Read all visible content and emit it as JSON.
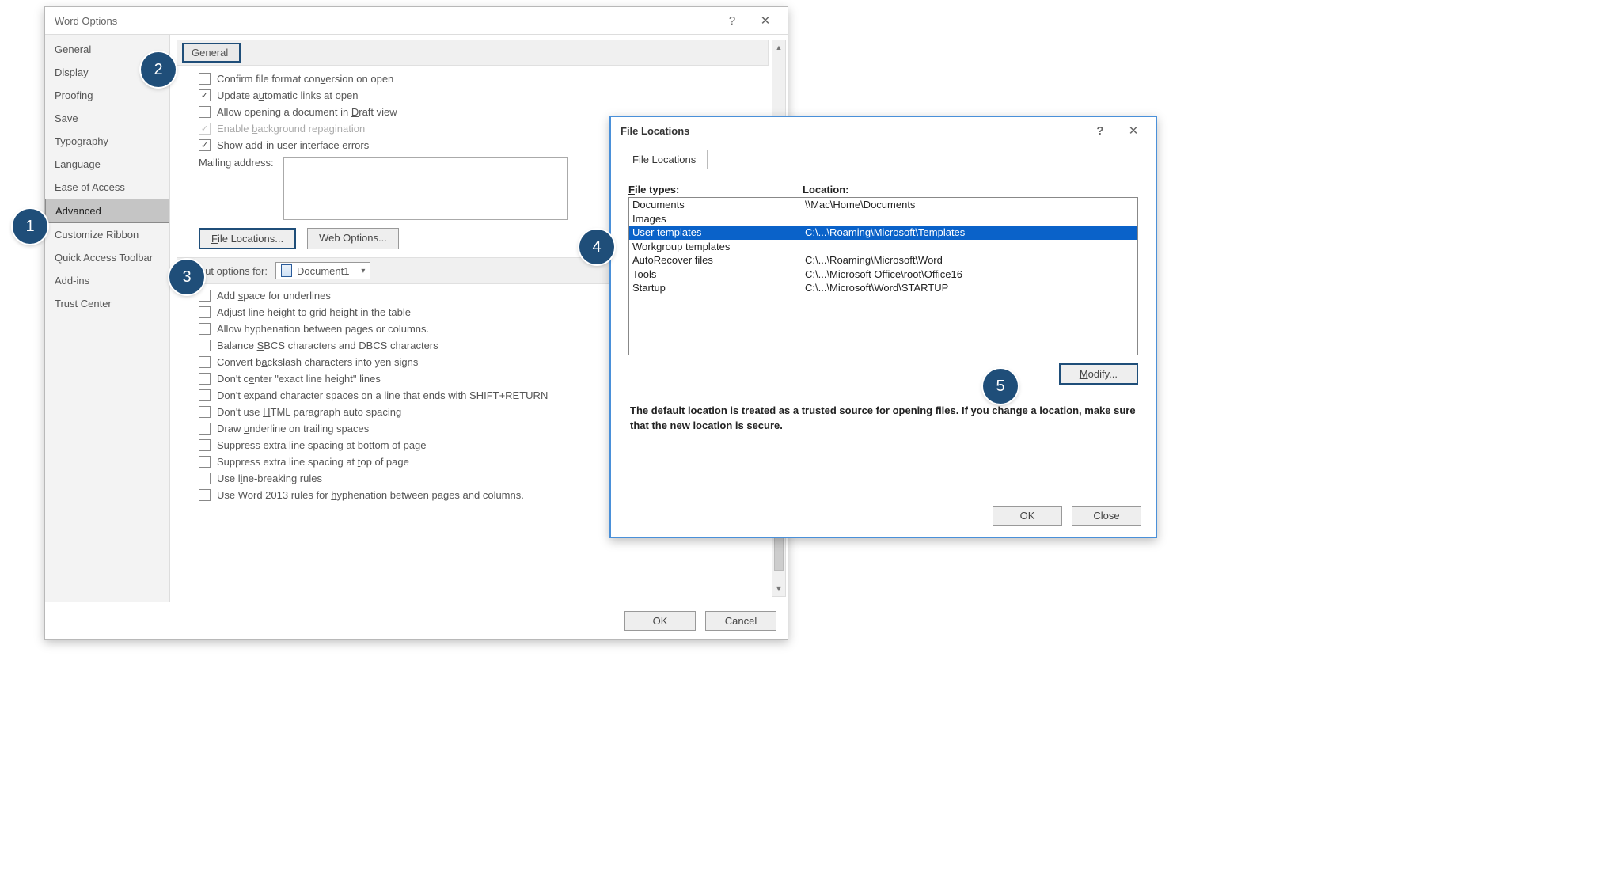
{
  "word_options": {
    "title": "Word Options",
    "sidebar": {
      "items": [
        {
          "label": "General",
          "selected": false
        },
        {
          "label": "Display",
          "selected": false
        },
        {
          "label": "Proofing",
          "selected": false
        },
        {
          "label": "Save",
          "selected": false
        },
        {
          "label": "Typography",
          "selected": false
        },
        {
          "label": "Language",
          "selected": false
        },
        {
          "label": "Ease of Access",
          "selected": false
        },
        {
          "label": "Advanced",
          "selected": true
        },
        {
          "label": "Customize Ribbon",
          "selected": false
        },
        {
          "label": "Quick Access Toolbar",
          "selected": false
        },
        {
          "label": "Add-ins",
          "selected": false
        },
        {
          "label": "Trust Center",
          "selected": false
        }
      ]
    },
    "general_section": {
      "header": "General",
      "checks": [
        {
          "label": "Confirm file format conversion on open",
          "checked": false,
          "disabled": false,
          "accel": "v"
        },
        {
          "label": "Update automatic links at open",
          "checked": true,
          "disabled": false,
          "accel": "u"
        },
        {
          "label": "Allow opening a document in Draft view",
          "checked": false,
          "disabled": false,
          "accel": "D"
        },
        {
          "label": "Enable background repagination",
          "checked": true,
          "disabled": true,
          "accel": "b"
        },
        {
          "label": "Show add-in user interface errors",
          "checked": true,
          "disabled": false,
          "accel": ""
        }
      ],
      "mailing_label": "Mailing address:",
      "file_locations_btn": "File Locations...",
      "web_options_btn": "Web Options..."
    },
    "layout_section": {
      "header": "Layout options for:",
      "document": "Document1",
      "checks": [
        "Add space for underlines",
        "Adjust line height to grid height in the table",
        "Allow hyphenation between pages or columns.",
        "Balance SBCS characters and DBCS characters",
        "Convert backslash characters into yen signs",
        "Don't center \"exact line height\" lines",
        "Don't expand character spaces on a line that ends with SHIFT+RETURN",
        "Don't use HTML paragraph auto spacing",
        "Draw underline on trailing spaces",
        "Suppress extra line spacing at bottom of page",
        "Suppress extra line spacing at top of page",
        "Use line-breaking rules",
        "Use Word 2013 rules for hyphenation between pages and columns."
      ]
    },
    "footer": {
      "ok": "OK",
      "cancel": "Cancel"
    }
  },
  "file_locations": {
    "title": "File Locations",
    "tab": "File Locations",
    "col1": "File types:",
    "col2": "Location:",
    "rows": [
      {
        "type": "Documents",
        "loc": "\\\\Mac\\Home\\Documents",
        "selected": false
      },
      {
        "type": "Images",
        "loc": "",
        "selected": false
      },
      {
        "type": "User templates",
        "loc": "C:\\...\\Roaming\\Microsoft\\Templates",
        "selected": true
      },
      {
        "type": "Workgroup templates",
        "loc": "",
        "selected": false
      },
      {
        "type": "AutoRecover files",
        "loc": "C:\\...\\Roaming\\Microsoft\\Word",
        "selected": false
      },
      {
        "type": "Tools",
        "loc": "C:\\...\\Microsoft Office\\root\\Office16",
        "selected": false
      },
      {
        "type": "Startup",
        "loc": "C:\\...\\Microsoft\\Word\\STARTUP",
        "selected": false
      }
    ],
    "modify_btn": "Modify...",
    "note": "The default location is treated as a trusted source for opening files. If you change a location, make sure that the new location is secure.",
    "footer": {
      "ok": "OK",
      "close": "Close"
    }
  },
  "callouts": {
    "1": "1",
    "2": "2",
    "3": "3",
    "4": "4",
    "5": "5"
  }
}
